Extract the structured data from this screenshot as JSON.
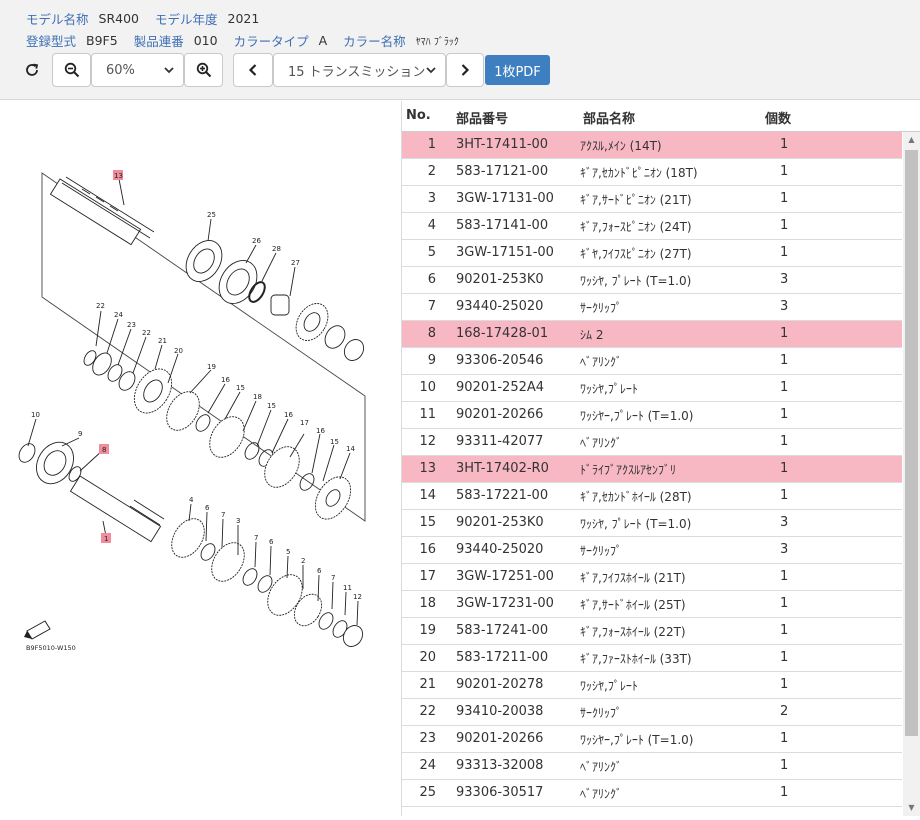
{
  "meta": {
    "model_name_label": "モデル名称",
    "model_name": "SR400",
    "model_year_label": "モデル年度",
    "model_year": "2021",
    "reg_type_label": "登録型式",
    "reg_type": "B9F5",
    "serial_label": "製品連番",
    "serial": "010",
    "color_type_label": "カラータイプ",
    "color_type": "A",
    "color_name_label": "カラー名称",
    "color_name": "ﾔﾏﾊ ﾌﾞﾗｯｸ"
  },
  "toolbar": {
    "zoom_value": "60%",
    "section_value": "15 トランスミッション",
    "pdf_label": "1枚PDF"
  },
  "table": {
    "headers": {
      "no": "No.",
      "part_number": "部品番号",
      "part_name": "部品名称",
      "qty": "個数"
    },
    "rows": [
      {
        "no": "1",
        "pn": "3HT-17411-00",
        "name": "ｱｸｽﾙ,ﾒｲﾝ (14T)",
        "qty": "1",
        "highlight": true
      },
      {
        "no": "2",
        "pn": "583-17121-00",
        "name": "ｷﾞｱ,ｾｶﾝﾄﾞﾋﾟﾆｵﾝ (18T)",
        "qty": "1",
        "highlight": false
      },
      {
        "no": "3",
        "pn": "3GW-17131-00",
        "name": "ｷﾞｱ,ｻｰﾄﾞﾋﾟﾆｵﾝ (21T)",
        "qty": "1",
        "highlight": false
      },
      {
        "no": "4",
        "pn": "583-17141-00",
        "name": "ｷﾞｱ,ﾌｫｰｽﾋﾟﾆｵﾝ (24T)",
        "qty": "1",
        "highlight": false
      },
      {
        "no": "5",
        "pn": "3GW-17151-00",
        "name": "ｷﾞﾔ,ﾌｲﾌｽﾋﾟﾆｵﾝ (27T)",
        "qty": "1",
        "highlight": false
      },
      {
        "no": "6",
        "pn": "90201-253K0",
        "name": "ﾜｯｼﾔ, ﾌﾟﾚｰﾄ (T=1.0)",
        "qty": "3",
        "highlight": false
      },
      {
        "no": "7",
        "pn": "93440-25020",
        "name": "ｻｰｸﾘｯﾌﾟ",
        "qty": "3",
        "highlight": false
      },
      {
        "no": "8",
        "pn": "168-17428-01",
        "name": "ｼﾑ 2",
        "qty": "1",
        "highlight": true
      },
      {
        "no": "9",
        "pn": "93306-20546",
        "name": "ﾍﾞｱﾘﾝｸﾞ",
        "qty": "1",
        "highlight": false
      },
      {
        "no": "10",
        "pn": "90201-252A4",
        "name": "ﾜｯｼﾔ,ﾌﾟﾚｰﾄ",
        "qty": "1",
        "highlight": false
      },
      {
        "no": "11",
        "pn": "90201-20266",
        "name": "ﾜｯｼﾔｰ,ﾌﾟﾚｰﾄ (T=1.0)",
        "qty": "1",
        "highlight": false
      },
      {
        "no": "12",
        "pn": "93311-42077",
        "name": "ﾍﾞｱﾘﾝｸﾞ",
        "qty": "1",
        "highlight": false
      },
      {
        "no": "13",
        "pn": "3HT-17402-R0",
        "name": "ﾄﾞﾗｲﾌﾞｱｸｽﾙｱｾﾝﾌﾞﾘ",
        "qty": "1",
        "highlight": true
      },
      {
        "no": "14",
        "pn": "583-17221-00",
        "name": "ｷﾞｱ,ｾｶﾝﾄﾞﾎｲｰﾙ (28T)",
        "qty": "1",
        "highlight": false
      },
      {
        "no": "15",
        "pn": "90201-253K0",
        "name": "ﾜｯｼﾔ, ﾌﾟﾚｰﾄ (T=1.0)",
        "qty": "3",
        "highlight": false
      },
      {
        "no": "16",
        "pn": "93440-25020",
        "name": "ｻｰｸﾘｯﾌﾟ",
        "qty": "3",
        "highlight": false
      },
      {
        "no": "17",
        "pn": "3GW-17251-00",
        "name": "ｷﾞｱ,ﾌｲﾌｽﾎｲｰﾙ (21T)",
        "qty": "1",
        "highlight": false
      },
      {
        "no": "18",
        "pn": "3GW-17231-00",
        "name": "ｷﾞｱ,ｻｰﾄﾞﾎｲｰﾙ (25T)",
        "qty": "1",
        "highlight": false
      },
      {
        "no": "19",
        "pn": "583-17241-00",
        "name": "ｷﾞｱ,ﾌｫｰｽﾎｲｰﾙ (22T)",
        "qty": "1",
        "highlight": false
      },
      {
        "no": "20",
        "pn": "583-17211-00",
        "name": "ｷﾞｱ,ﾌｧｰｽﾄﾎｲｰﾙ (33T)",
        "qty": "1",
        "highlight": false
      },
      {
        "no": "21",
        "pn": "90201-20278",
        "name": "ﾜｯｼﾔ,ﾌﾟﾚｰﾄ",
        "qty": "1",
        "highlight": false
      },
      {
        "no": "22",
        "pn": "93410-20038",
        "name": "ｻｰｸﾘｯﾌﾟ",
        "qty": "2",
        "highlight": false
      },
      {
        "no": "23",
        "pn": "90201-20266",
        "name": "ﾜｯｼﾔｰ,ﾌﾟﾚｰﾄ (T=1.0)",
        "qty": "1",
        "highlight": false
      },
      {
        "no": "24",
        "pn": "93313-32008",
        "name": "ﾍﾞｱﾘﾝｸﾞ",
        "qty": "1",
        "highlight": false
      },
      {
        "no": "25",
        "pn": "93306-30517",
        "name": "ﾍﾞｱﾘﾝｸﾞ",
        "qty": "1",
        "highlight": false
      }
    ]
  },
  "diagram": {
    "code": "B9F5010-W150",
    "callouts": [
      "1",
      "2",
      "3",
      "4",
      "5",
      "6",
      "7",
      "8",
      "9",
      "10",
      "11",
      "12",
      "13",
      "14",
      "15",
      "16",
      "17",
      "18",
      "19",
      "20",
      "21",
      "22",
      "23",
      "24",
      "25",
      "26",
      "27",
      "28"
    ],
    "highlight_color": "#f08c9c"
  }
}
